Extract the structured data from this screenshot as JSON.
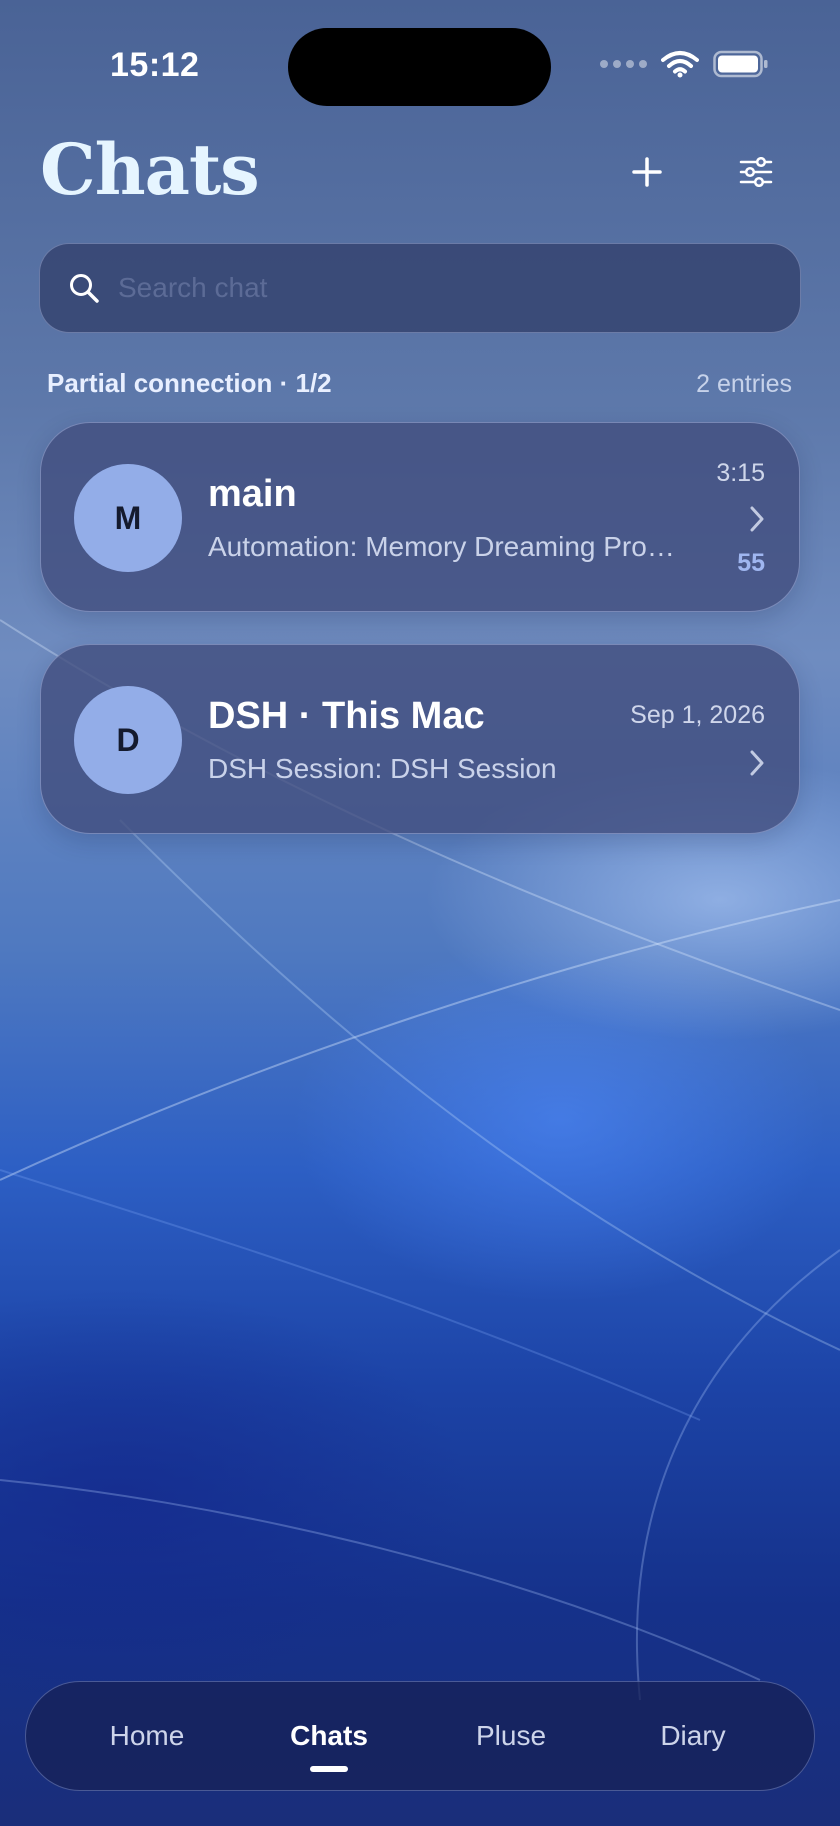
{
  "status_bar": {
    "time": "15:12"
  },
  "header": {
    "title": "Chats"
  },
  "search": {
    "placeholder": "Search chat"
  },
  "section": {
    "title": "Partial connection · 1/2",
    "count": "2 entries"
  },
  "chats": [
    {
      "avatar": "M",
      "name": "main",
      "preview": "Automation: Memory Dreaming Promotion",
      "time": "3:15",
      "unread": "55"
    },
    {
      "avatar": "D",
      "name": "DSH · This Mac",
      "preview": "DSH Session: DSH Session",
      "time": "Sep 1, 2026"
    }
  ],
  "tabs": [
    {
      "label": "Home"
    },
    {
      "label": "Chats",
      "active": true
    },
    {
      "label": "Pluse"
    },
    {
      "label": "Diary"
    }
  ],
  "colors": {
    "avatar": "#93ade8",
    "unread": "#9fb6f0",
    "title": "#e6f5ff"
  },
  "icons": [
    "wifi-icon",
    "battery-icon",
    "plus-icon",
    "filter-sliders-icon",
    "search-icon",
    "chevron-right-icon"
  ]
}
